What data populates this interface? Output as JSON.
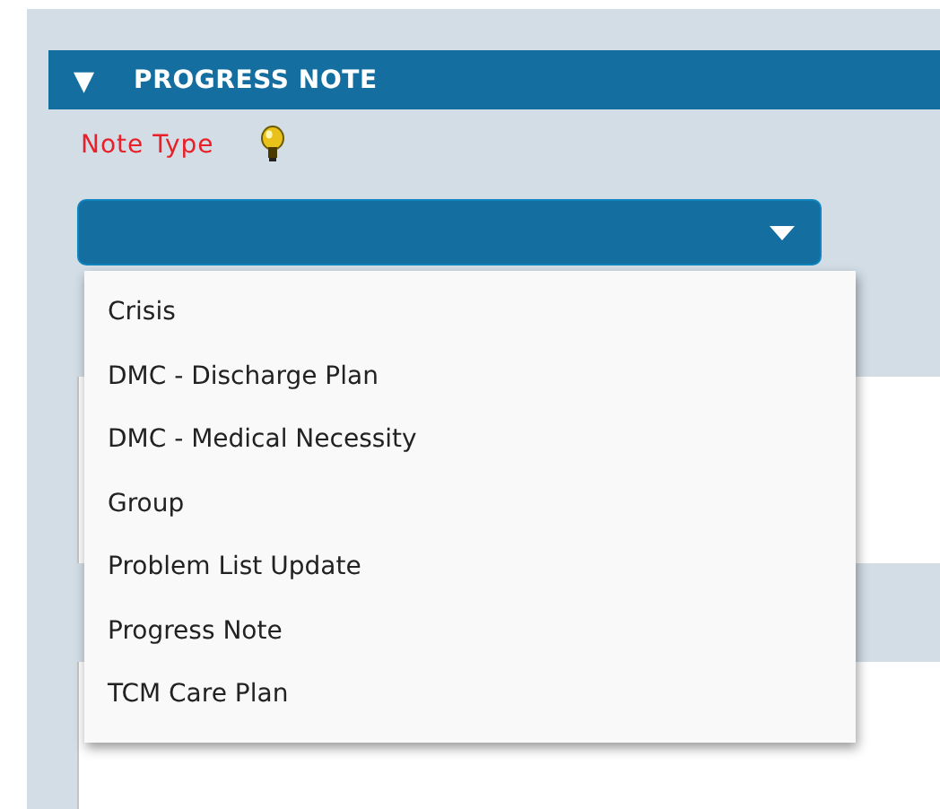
{
  "section": {
    "toggle": "▼",
    "title": "PROGRESS NOTE"
  },
  "note_type": {
    "label": "Note Type",
    "required": true,
    "dropdown": {
      "open": true,
      "options": [
        {
          "label": "Crisis",
          "selected": false
        },
        {
          "label": "DMC - Discharge Plan",
          "selected": false
        },
        {
          "label": "DMC - Medical Necessity",
          "selected": false
        },
        {
          "label": "Group",
          "selected": false
        },
        {
          "label": "Problem List Update",
          "selected": false
        },
        {
          "label": "Progress Note",
          "selected": false
        },
        {
          "label": "TCM Care Plan",
          "selected": false
        }
      ]
    }
  }
}
